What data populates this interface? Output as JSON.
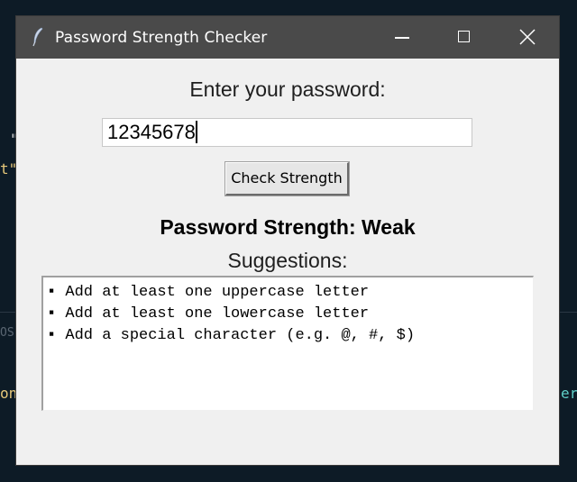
{
  "window": {
    "title": "Password Strength Checker"
  },
  "form": {
    "prompt": "Enter your password:",
    "password_value": "12345678",
    "check_button_label": "Check Strength"
  },
  "result": {
    "strength_text": "Password Strength: Weak",
    "suggestions_label": "Suggestions:",
    "suggestions": [
      "▪ Add at least one uppercase letter",
      "▪ Add at least one lowercase letter",
      "▪ Add a special character (e.g. @, #, $)"
    ]
  },
  "background": {
    "frag_quote": "\"",
    "frag_t": "t\"",
    "frag_os": "OS",
    "frag_on": "on",
    "frag_er": "er"
  },
  "colors": {
    "titlebar": "#4a4a4a",
    "window_bg": "#f0f0f0",
    "desktop_bg": "#0d1b26",
    "code_yellow": "#e6c87a",
    "code_teal": "#5fd0c8"
  }
}
